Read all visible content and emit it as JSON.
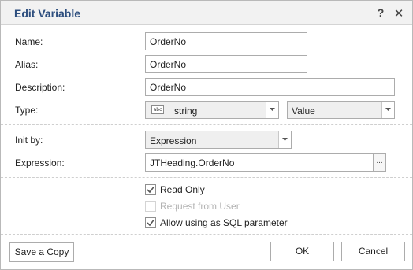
{
  "dialog": {
    "title": "Edit Variable",
    "help": "?",
    "close": "✕"
  },
  "fields": {
    "name_label": "Name:",
    "name_value": "OrderNo",
    "alias_label": "Alias:",
    "alias_value": "OrderNo",
    "description_label": "Description:",
    "description_value": "OrderNo",
    "type_label": "Type:",
    "type_icon_text": "abc",
    "type_value": "string",
    "type_kind_value": "Value",
    "init_label": "Init by:",
    "init_value": "Expression",
    "expression_label": "Expression:",
    "expression_value": "JTHeading.OrderNo",
    "expression_button": "..."
  },
  "options": {
    "read_only_label": "Read Only",
    "read_only_checked": true,
    "request_label": "Request from User",
    "request_checked": false,
    "request_disabled": true,
    "sql_param_label": "Allow using as SQL parameter",
    "sql_param_checked": true
  },
  "buttons": {
    "save_copy": "Save a Copy",
    "ok": "OK",
    "cancel": "Cancel"
  }
}
